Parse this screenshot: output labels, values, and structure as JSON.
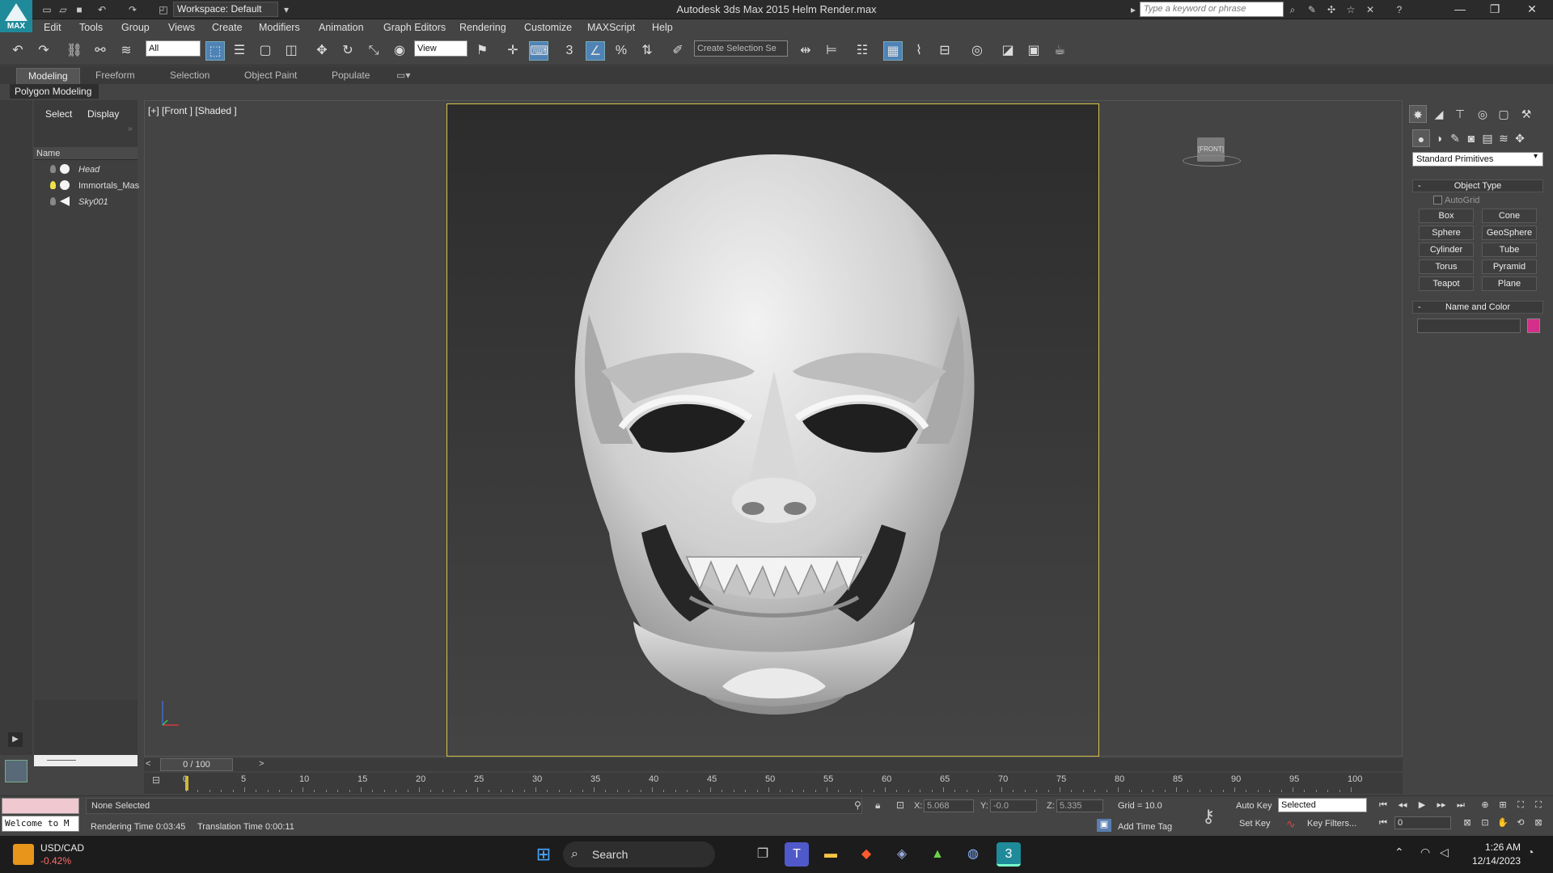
{
  "titlebar": {
    "logo_text": "MAX",
    "workspace": "Workspace: Default",
    "app_title": "Autodesk 3ds Max  2015     Helm Render.max",
    "search_placeholder": "Type a keyword or phrase"
  },
  "menu": [
    "Edit",
    "Tools",
    "Group",
    "Views",
    "Create",
    "Modifiers",
    "Animation",
    "Graph Editors",
    "Rendering",
    "Customize",
    "MAXScript",
    "Help"
  ],
  "toolbar": {
    "selection_filter": "All",
    "ref_coord": "View",
    "snap_3": "3",
    "named_selection": "Create Selection Se"
  },
  "ribbon": {
    "tabs": [
      "Modeling",
      "Freeform",
      "Selection",
      "Object Paint",
      "Populate"
    ],
    "active_tab": "Modeling",
    "panel": "Polygon Modeling"
  },
  "explorer": {
    "tabs": [
      "Select",
      "Display"
    ],
    "column": "Name",
    "items": [
      {
        "name": "Head",
        "italic": true,
        "light": false
      },
      {
        "name": "Immortals_Mas",
        "italic": false,
        "light": true
      },
      {
        "name": "Sky001",
        "italic": true,
        "light": false
      }
    ]
  },
  "viewport": {
    "label": "[+] [Front ] [Shaded ]",
    "viewcube_label": "[FRONT]"
  },
  "command_panel": {
    "primitive_type": "Standard Primitives",
    "object_type_title": "Object Type",
    "autogrid": "AutoGrid",
    "buttons": [
      "Box",
      "Cone",
      "Sphere",
      "GeoSphere",
      "Cylinder",
      "Tube",
      "Torus",
      "Pyramid",
      "Teapot",
      "Plane"
    ],
    "name_color_title": "Name and Color",
    "object_color": "#d42f8a"
  },
  "timeline": {
    "frame_display": "0 / 100",
    "ticks": [
      "0",
      "5",
      "10",
      "15",
      "20",
      "25",
      "30",
      "35",
      "40",
      "45",
      "50",
      "55",
      "60",
      "65",
      "70",
      "75",
      "80",
      "85",
      "90",
      "95",
      "100"
    ]
  },
  "status": {
    "maxscript_text": "Welcome to M",
    "selection": "None Selected",
    "render_time": "Rendering Time  0:03:45",
    "translation_time": "Translation Time  0:00:11",
    "x_label": "X:",
    "x_value": "5.068",
    "y_label": "Y:",
    "y_value": "-0.0",
    "z_label": "Z:",
    "z_value": "5.335",
    "grid": "Grid = 10.0",
    "add_time_tag": "Add Time Tag",
    "auto_key": "Auto Key",
    "set_key": "Set Key",
    "key_mode": "Selected",
    "key_filters": "Key Filters...",
    "frame_field": "0"
  },
  "taskbar": {
    "ticker_name": "USD/CAD",
    "ticker_change": "-0.42%",
    "search": "Search",
    "time": "1:26 AM",
    "date": "12/14/2023"
  }
}
